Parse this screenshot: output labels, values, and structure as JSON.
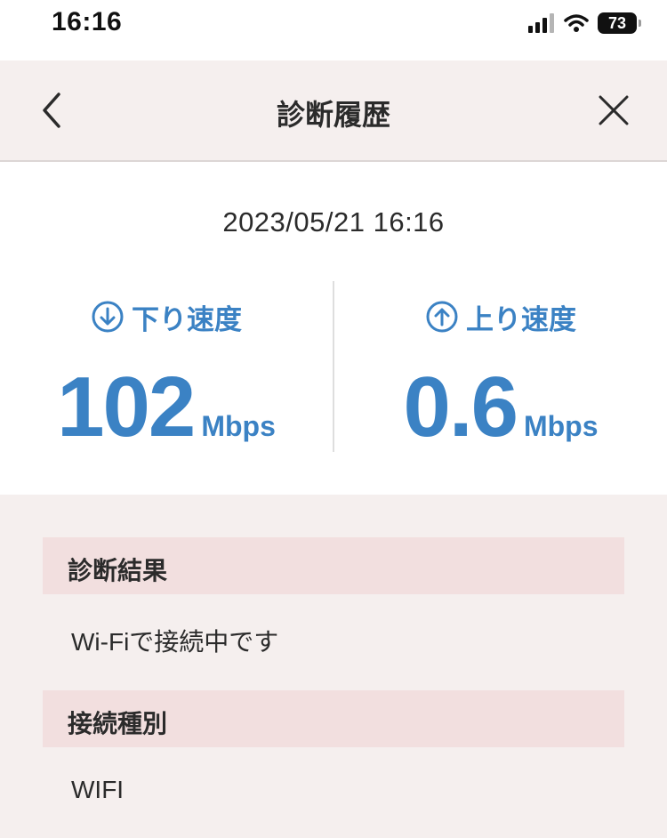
{
  "status_bar": {
    "time": "16:16",
    "battery": "73"
  },
  "nav": {
    "title": "診断履歴",
    "back_icon": "chevron-left-icon",
    "close_icon": "close-icon"
  },
  "result": {
    "datetime": "2023/05/21 16:16",
    "download": {
      "label": "下り速度",
      "value": "102",
      "unit": "Mbps",
      "icon": "arrow-down-circle-icon"
    },
    "upload": {
      "label": "上り速度",
      "value": "0.6",
      "unit": "Mbps",
      "icon": "arrow-up-circle-icon"
    }
  },
  "sections": [
    {
      "header": "診断結果",
      "value": "Wi-Fiで接続中です"
    },
    {
      "header": "接続種別",
      "value": "WIFI"
    }
  ],
  "colors": {
    "accent": "#3b82c4",
    "background": "#f5efee",
    "section_header": "#f2dfdf"
  }
}
